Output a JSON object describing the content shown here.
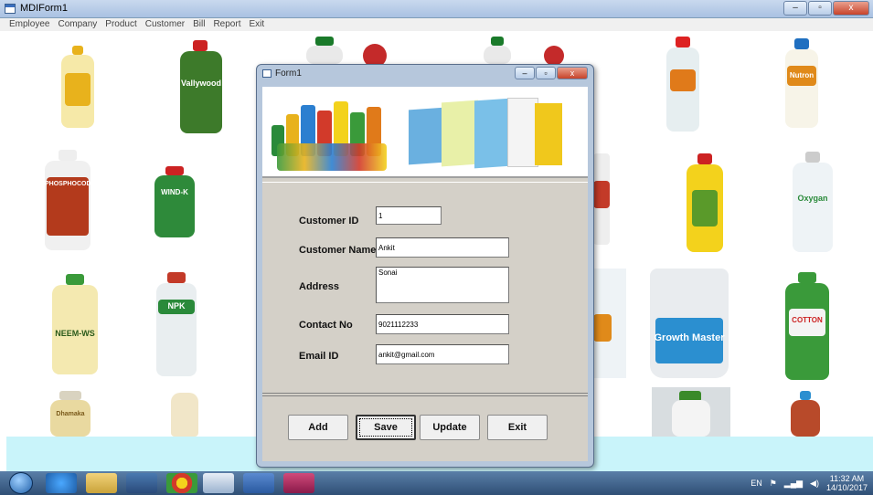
{
  "window": {
    "title": "MDIForm1",
    "minimize": "–",
    "maximize": "▫",
    "close": "x"
  },
  "menu": [
    "Employee",
    "Company",
    "Product",
    "Customer",
    "Bill",
    "Report",
    "Exit"
  ],
  "form": {
    "title": "Form1",
    "fields": {
      "customer_id": {
        "label": "Customer ID",
        "value": "1"
      },
      "customer_name": {
        "label": "Customer Name",
        "value": "Ankit"
      },
      "address": {
        "label": "Address",
        "value": "Sonai"
      },
      "contact_no": {
        "label": "Contact No",
        "value": "9021112233"
      },
      "email_id": {
        "label": "Email ID",
        "value": "ankit@gmail.com"
      }
    },
    "buttons": {
      "add": "Add",
      "save": "Save",
      "update": "Update",
      "exit": "Exit"
    }
  },
  "products": [
    {
      "name": "Vallywood",
      "color": "#3d7a2a"
    },
    {
      "name": "PHOSPHOCOD",
      "color": "#b33a1c"
    },
    {
      "name": "WIND-K",
      "color": "#2e7fc0"
    },
    {
      "name": "NEEM-WS",
      "color": "#d4b21c"
    },
    {
      "name": "NPK",
      "color": "#c33a28"
    },
    {
      "name": "Nutron",
      "color": "#e08a1a"
    },
    {
      "name": "Oxygan",
      "color": "#2a8a3a"
    },
    {
      "name": "Growth Master",
      "color": "#2b8fd0"
    },
    {
      "name": "COTTON",
      "color": "#3a9a3a"
    },
    {
      "name": "Dhamaka",
      "color": "#8a7a3a"
    }
  ],
  "taskbar": {
    "language": "EN",
    "time": "11:32 AM",
    "date": "14/10/2017"
  }
}
